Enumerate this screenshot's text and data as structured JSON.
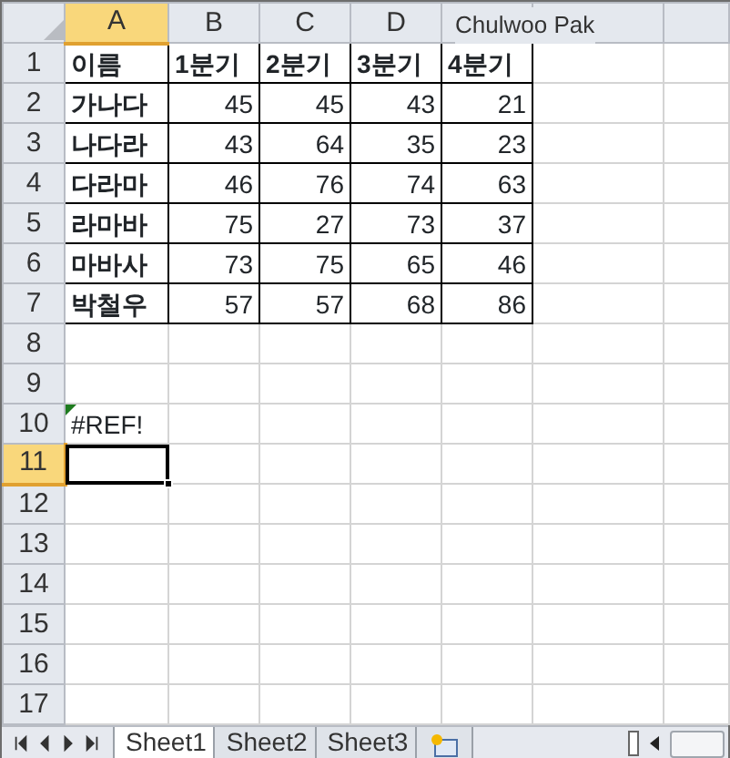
{
  "columns": [
    {
      "label": "A",
      "selected": true
    },
    {
      "label": "B",
      "selected": false
    },
    {
      "label": "C",
      "selected": false
    },
    {
      "label": "D",
      "selected": false
    }
  ],
  "author_tag": "Chulwoo Pak",
  "rows": [
    {
      "number": "1",
      "selected": false,
      "cells": [
        {
          "text": "이름",
          "kind": "label"
        },
        {
          "text": "1분기",
          "kind": "label"
        },
        {
          "text": "2분기",
          "kind": "label"
        },
        {
          "text": "3분기",
          "kind": "label"
        },
        {
          "text": "4분기",
          "kind": "label"
        }
      ]
    },
    {
      "number": "2",
      "selected": false,
      "cells": [
        {
          "text": "가나다",
          "kind": "label"
        },
        {
          "text": "45",
          "kind": "number"
        },
        {
          "text": "45",
          "kind": "number"
        },
        {
          "text": "43",
          "kind": "number"
        },
        {
          "text": "21",
          "kind": "number"
        }
      ]
    },
    {
      "number": "3",
      "selected": false,
      "cells": [
        {
          "text": "나다라",
          "kind": "label"
        },
        {
          "text": "43",
          "kind": "number"
        },
        {
          "text": "64",
          "kind": "number"
        },
        {
          "text": "35",
          "kind": "number"
        },
        {
          "text": "23",
          "kind": "number"
        }
      ]
    },
    {
      "number": "4",
      "selected": false,
      "cells": [
        {
          "text": "다라마",
          "kind": "label"
        },
        {
          "text": "46",
          "kind": "number"
        },
        {
          "text": "76",
          "kind": "number"
        },
        {
          "text": "74",
          "kind": "number"
        },
        {
          "text": "63",
          "kind": "number"
        }
      ]
    },
    {
      "number": "5",
      "selected": false,
      "cells": [
        {
          "text": "라마바",
          "kind": "label"
        },
        {
          "text": "75",
          "kind": "number"
        },
        {
          "text": "27",
          "kind": "number"
        },
        {
          "text": "73",
          "kind": "number"
        },
        {
          "text": "37",
          "kind": "number"
        }
      ]
    },
    {
      "number": "6",
      "selected": false,
      "cells": [
        {
          "text": "마바사",
          "kind": "label"
        },
        {
          "text": "73",
          "kind": "number"
        },
        {
          "text": "75",
          "kind": "number"
        },
        {
          "text": "65",
          "kind": "number"
        },
        {
          "text": "46",
          "kind": "number"
        }
      ]
    },
    {
      "number": "7",
      "selected": false,
      "cells": [
        {
          "text": "박철우",
          "kind": "label"
        },
        {
          "text": "57",
          "kind": "number"
        },
        {
          "text": "57",
          "kind": "number"
        },
        {
          "text": "68",
          "kind": "number"
        },
        {
          "text": "86",
          "kind": "number"
        }
      ]
    },
    {
      "number": "8",
      "selected": false
    },
    {
      "number": "9",
      "selected": false
    },
    {
      "number": "10",
      "selected": false,
      "cells": [
        {
          "text": "#REF!",
          "kind": "error"
        }
      ]
    },
    {
      "number": "11",
      "selected": true
    },
    {
      "number": "12",
      "selected": false
    },
    {
      "number": "13",
      "selected": false
    },
    {
      "number": "14",
      "selected": false
    },
    {
      "number": "15",
      "selected": false
    },
    {
      "number": "16",
      "selected": false
    },
    {
      "number": "17",
      "selected": false
    }
  ],
  "sheet_tabs": [
    {
      "label": "Sheet1",
      "selected": true
    },
    {
      "label": "Sheet2",
      "selected": false
    },
    {
      "label": "Sheet3",
      "selected": false
    }
  ]
}
